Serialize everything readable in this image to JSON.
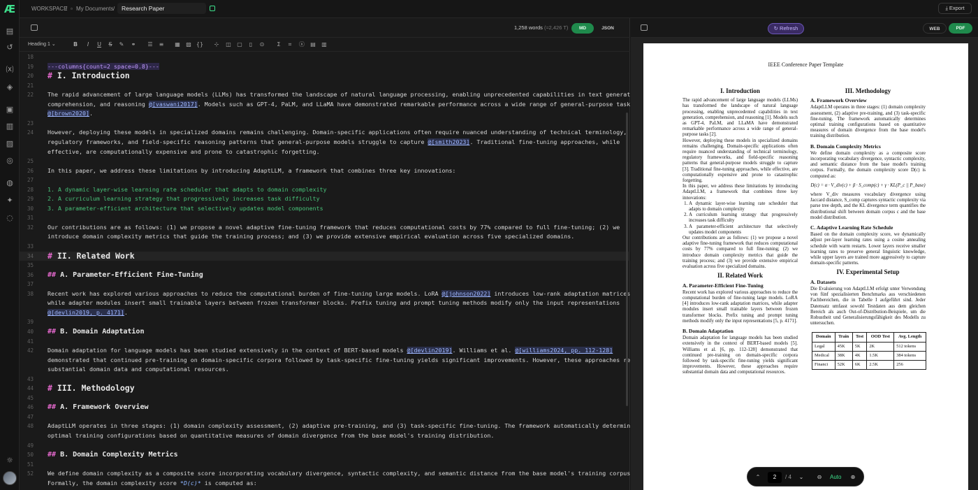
{
  "app": {
    "logo_text": "Æ"
  },
  "breadcrumb": {
    "workspace": "WORKSPACE",
    "sep1": "/",
    "folder": "My Documents",
    "sep2": "/",
    "doc_title": "Research Paper"
  },
  "toolbar": {
    "export": "Export",
    "heading_select": "Heading 1 ⌄"
  },
  "editor_header": {
    "word_count": "1,258",
    "word_label": "words",
    "token_count": "(≈2,426 T)",
    "md": "MD",
    "json": "JSON"
  },
  "preview_header": {
    "refresh": "Refresh",
    "web": "WEB",
    "pdf": "PDF"
  },
  "lines": [
    {
      "n": "18",
      "t": ""
    },
    {
      "n": "19",
      "t": "---columns{count=2 space=0.8}---"
    },
    {
      "n": "20",
      "h": "#",
      "t": " I. Introduction"
    },
    {
      "n": "21",
      "t": ""
    },
    {
      "n": "22",
      "t": "The rapid advancement of large language models (LLMs) has transformed the landscape of natural language processing, enabling unprecedented capabilities in text generation,"
    },
    {
      "n": "",
      "a": "comprehension, and reasoning ",
      "c": "@[vaswani2017]",
      "b": ". Models such as GPT-4, PaLM, and LLaMA have demonstrated remarkable performance across a wide range of general-purpose tasks"
    },
    {
      "n": "",
      "c": "@[brown2020]",
      "b": "."
    },
    {
      "n": "23",
      "t": ""
    },
    {
      "n": "24",
      "t": "However, deploying these models in specialized domains remains challenging. Domain-specific applications often require nuanced understanding of technical terminology,"
    },
    {
      "n": "",
      "a": "regulatory frameworks, and field-specific reasoning patterns that general-purpose models struggle to capture ",
      "c": "@[smith2023]",
      "b": ". Traditional fine-tuning approaches, while"
    },
    {
      "n": "",
      "t": "effective, are computationally expensive and prone to catastrophic forgetting."
    },
    {
      "n": "25",
      "t": ""
    },
    {
      "n": "26",
      "t": "In this paper, we address these limitations by introducing AdaptLLM, a framework that combines three key innovations:"
    },
    {
      "n": "27",
      "t": ""
    },
    {
      "n": "28",
      "l": "1. A dynamic layer-wise learning rate scheduler that adapts to domain complexity"
    },
    {
      "n": "29",
      "l": "2. A curriculum learning strategy that progressively increases task difficulty"
    },
    {
      "n": "30",
      "l": "3. A parameter-efficient architecture that selectively updates model components"
    },
    {
      "n": "31",
      "t": ""
    },
    {
      "n": "32",
      "t": "Our contributions are as follows: (1) we propose a novel adaptive fine-tuning framework that reduces computational costs by 77% compared to full fine-tuning; (2) we"
    },
    {
      "n": "",
      "t": "introduce domain complexity metrics that guide the training process; and (3) we provide extensive empirical evaluation across five specialized domains."
    },
    {
      "n": "33",
      "t": ""
    },
    {
      "n": "34",
      "h": "#",
      "t": " II. Related Work",
      "cur": true
    },
    {
      "n": "35",
      "t": ""
    },
    {
      "n": "36",
      "h2": "##",
      "t": " A. Parameter-Efficient Fine-Tuning"
    },
    {
      "n": "37",
      "t": ""
    },
    {
      "n": "38",
      "a": "Recent work has explored various approaches to reduce the computational burden of fine-tuning large models. LoRA ",
      "c": "@[johnson2022]",
      "b": " introduces low-rank adaptation matrices,"
    },
    {
      "n": "",
      "t": "while adapter modules insert small trainable layers between frozen transformer blocks. Prefix tuning and prompt tuning methods modify only the input representations"
    },
    {
      "n": "",
      "c": "@[devlin2019, p. 4171]",
      "b": "."
    },
    {
      "n": "39",
      "t": ""
    },
    {
      "n": "40",
      "h2": "##",
      "t": " B. Domain Adaptation"
    },
    {
      "n": "41",
      "t": ""
    },
    {
      "n": "42",
      "a": "Domain adaptation for language models has been studied extensively in the context of BERT-based models ",
      "c": "@[devlin2019]",
      "b": ". Williams et al. ",
      "c2": "@[williams2024, pp. 112-128]"
    },
    {
      "n": "",
      "t": "demonstrated that continued pre-training on domain-specific corpora followed by task-specific fine-tuning yields significant improvements. However, these approaches require"
    },
    {
      "n": "",
      "t": "substantial domain data and computational resources."
    },
    {
      "n": "43",
      "t": ""
    },
    {
      "n": "44",
      "h": "#",
      "t": " III. Methodology"
    },
    {
      "n": "45",
      "t": ""
    },
    {
      "n": "46",
      "h2": "##",
      "t": " A. Framework Overview"
    },
    {
      "n": "47",
      "t": ""
    },
    {
      "n": "48",
      "t": "AdaptLLM operates in three stages: (1) domain complexity assessment, (2) adaptive pre-training, and (3) task-specific fine-tuning. The framework automatically determines"
    },
    {
      "n": "",
      "t": "optimal training configurations based on quantitative measures of domain divergence from the base model's training distribution."
    },
    {
      "n": "49",
      "t": ""
    },
    {
      "n": "50",
      "h2": "##",
      "t": " B. Domain Complexity Metrics"
    },
    {
      "n": "51",
      "t": ""
    },
    {
      "n": "52",
      "t": "We define domain complexity as a composite score incorporating vocabulary divergence, syntactic complexity, and semantic distance from the base model's training corpus."
    },
    {
      "n": "",
      "a": "Formally, the domain complexity score ",
      "e": "*D(c)*",
      "b": " is computed as:"
    },
    {
      "n": "53",
      "t": ""
    }
  ],
  "paper": {
    "header": "IEEE Conference Paper Template",
    "intro_h": "I. Introduction",
    "intro_p1": "The rapid advancement of large language models (LLMs) has transformed the landscape of natural language processing, enabling unprecedented capabilities in text generation, comprehension, and reasoning [1]. Models such as GPT-4, PaLM, and LLaMA have demonstrated remarkable performance across a wide range of general-purpose tasks [2].",
    "intro_p2": "However, deploying these models in specialized domains remains challenging. Domain-specific applications often require nuanced understanding of technical terminology, regulatory frameworks, and field-specific reasoning patterns that general-purpose models struggle to capture [3]. Traditional fine-tuning approaches, while effective, are computationally expensive and prone to catastrophic forgetting.",
    "intro_p3": "In this paper, we address these limitations by introducing AdaptLLM, a framework that combines three key innovations:",
    "intro_l1": "A dynamic layer-wise learning rate scheduler that adapts to domain complexity",
    "intro_l2": "A curriculum learning strategy that progressively increases task difficulty",
    "intro_l3": "A parameter-efficient architecture that selectively updates model components",
    "intro_p4": "Our contributions are as follows: (1) we propose a novel adaptive fine-tuning framework that reduces computational costs by 77% compared to full fine-tuning; (2) we introduce domain complexity metrics that guide the training process; and (3) we provide extensive empirical evaluation across five specialized domains.",
    "related_h": "II. Related Work",
    "peft_h": "A. Parameter-Efficient Fine-Tuning",
    "peft_p": "Recent work has explored various approaches to reduce the computational burden of fine-tuning large models. LoRA [4] introduces low-rank adaptation matrices, while adapter modules insert small trainable layers between frozen transformer blocks. Prefix tuning and prompt tuning methods modify only the input representations [5, p. 4171].",
    "da_h": "B. Domain Adaptation",
    "da_p": "Domain adaptation for language models has been studied extensively in the context of BERT-based models [5]. Williams et al. [6, pp. 112-128] demonstrated that continued pre-training on domain-specific corpora followed by task-specific fine-tuning yields significant improvements. However, these approaches require substantial domain data and computational resources.",
    "method_h": "III. Methodology",
    "fo_h": "A. Framework Overview",
    "fo_p": "AdaptLLM operates in three stages: (1) domain complexity assessment, (2) adaptive pre-training, and (3) task-specific fine-tuning. The framework automatically determines optimal training configurations based on quantitative measures of domain divergence from the base model's training distribution.",
    "dcm_h": "B. Domain Complexity Metrics",
    "dcm_p": "We define domain complexity as a composite score incorporating vocabulary divergence, syntactic complexity, and semantic distance from the base model's training corpus. Formally, the domain complexity score D(c) is computed as:",
    "formula": "D(c) = α · V_div(c) + β · S_comp(c) + γ · KL(P_c || P_base)",
    "dcm_p2": "where V_div measures vocabulary divergence using Jaccard distance, S_comp captures syntactic complexity via parse tree depth, and the KL divergence term quantifies the distributional shift between domain corpus c and the base model distribution.",
    "alr_h": "C. Adaptive Learning Rate Schedule",
    "alr_p": "Based on the domain complexity score, we dynamically adjust per-layer learning rates using a cosine annealing schedule with warm restarts. Lower layers receive smaller learning rates to preserve general linguistic knowledge, while upper layers are trained more aggressively to capture domain-specific patterns.",
    "exp_h": "IV. Experimental Setup",
    "ds_h": "A. Datasets",
    "ds_p": "Die Evaluierung von AdaptLLM erfolgt unter Verwendung von fünf spezialisierten Benchmarks aus verschiedenen Fachbereichen, die in Tabelle I aufgeführt sind. Jeder Datensatz umfasst sowohl Testdaten aus dem gleichen Bereich als auch Out-of-Distribution-Beispiele, um die Robustheit und Generalisierungsfähigkeit des Modells zu untersuchen.",
    "table": {
      "headers": [
        "Domain",
        "Train",
        "Test",
        "OOD Test",
        "Avg. Length"
      ],
      "rows": [
        [
          "Legal",
          "45K",
          "5K",
          "2K",
          "512 tokens"
        ],
        [
          "Medical",
          "38K",
          "4K",
          "1.5K",
          "384 tokens"
        ],
        [
          "Financi",
          "52K",
          "6K",
          "2.5K",
          "256"
        ]
      ]
    }
  },
  "pager": {
    "up": "⌃",
    "page": "2",
    "total": "/ 4",
    "down": "⌄",
    "zoom_out": "⊖",
    "zoom": "Auto",
    "zoom_in": "⊕"
  }
}
